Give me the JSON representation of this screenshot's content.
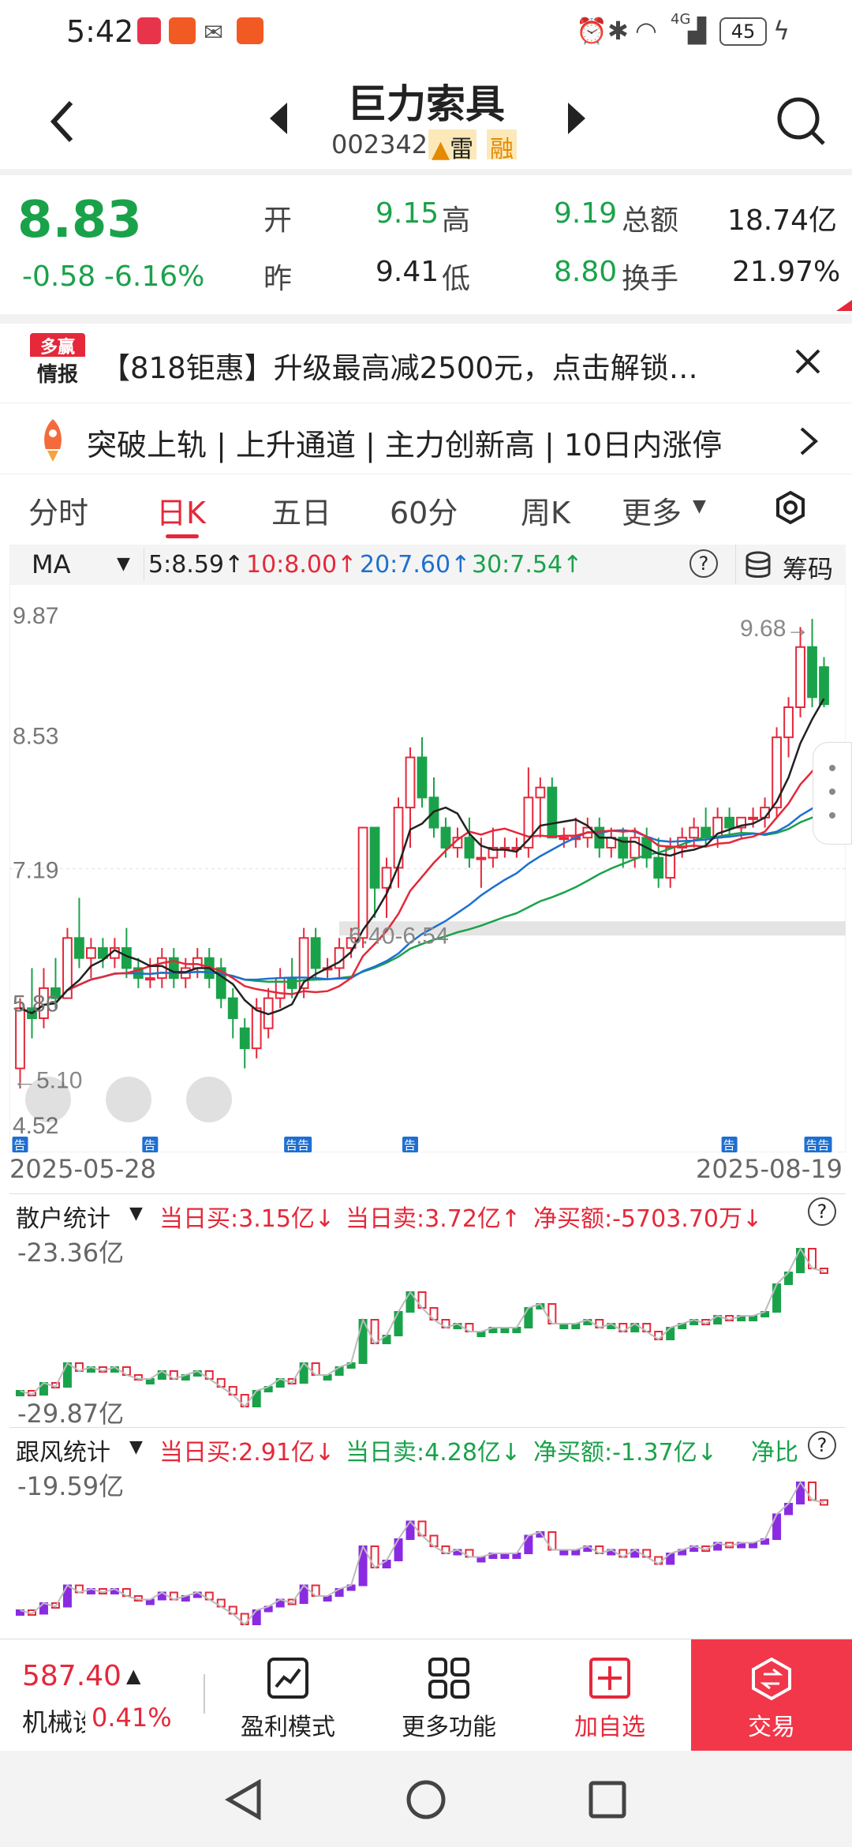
{
  "status": {
    "time": "5:42",
    "battery": "45",
    "network": "4G"
  },
  "nav": {
    "title": "巨力索具",
    "code": "002342",
    "lei": "雷",
    "rong": "融"
  },
  "quote": {
    "price": "8.83",
    "change": "-0.58",
    "pct": "-6.16%",
    "open_label": "开",
    "open": "9.15",
    "high_label": "高",
    "high": "9.19",
    "amount_label": "总额",
    "amount": "18.74亿",
    "prev_label": "昨",
    "prev": "9.41",
    "low_label": "低",
    "low": "8.80",
    "turnover_label": "换手",
    "turnover": "21.97%"
  },
  "ad": {
    "logo_top": "多赢",
    "logo_bottom": "情报",
    "text": "【818钜惠】升级最高减2500元，点击解锁…"
  },
  "ticker": {
    "text": "突破上轨 | 上升通道 | 主力创新高 | 10日内涨停"
  },
  "tabs": [
    "分时",
    "日K",
    "五日",
    "60分",
    "周K",
    "更多"
  ],
  "active_tab": "日K",
  "ma": {
    "label": "MA",
    "ma5": "5:8.59↑",
    "ma10": "10:8.00↑",
    "ma20": "20:7.60↑",
    "ma30": "30:7.54↑",
    "chips": "筹码"
  },
  "chart_data": {
    "type": "candlestick",
    "y_ticks": [
      "9.87",
      "8.53",
      "7.19",
      "5.86",
      "4.52"
    ],
    "ylim": [
      4.52,
      9.87
    ],
    "date_start": "2025-05-28",
    "date_end": "2025-08-19",
    "max_label": "9.68→",
    "zone_label": "6.40-6.54",
    "min_label": "←5.10",
    "ohlc": [
      [
        5.2,
        5.9,
        5.0,
        5.8
      ],
      [
        5.8,
        6.2,
        5.5,
        5.7
      ],
      [
        5.7,
        6.2,
        5.6,
        6.0
      ],
      [
        6.0,
        6.3,
        5.8,
        5.9
      ],
      [
        5.9,
        6.6,
        5.9,
        6.5
      ],
      [
        6.5,
        6.9,
        6.2,
        6.3
      ],
      [
        6.3,
        6.5,
        6.1,
        6.4
      ],
      [
        6.4,
        6.5,
        6.2,
        6.3
      ],
      [
        6.3,
        6.5,
        6.2,
        6.4
      ],
      [
        6.4,
        6.6,
        6.1,
        6.2
      ],
      [
        6.2,
        6.3,
        6.0,
        6.1
      ],
      [
        6.1,
        6.3,
        6.0,
        6.1
      ],
      [
        6.1,
        6.4,
        6.0,
        6.3
      ],
      [
        6.3,
        6.4,
        6.0,
        6.1
      ],
      [
        6.1,
        6.3,
        6.0,
        6.2
      ],
      [
        6.2,
        6.4,
        6.1,
        6.3
      ],
      [
        6.3,
        6.4,
        6.0,
        6.1
      ],
      [
        6.2,
        6.3,
        5.8,
        5.9
      ],
      [
        5.9,
        6.0,
        5.5,
        5.7
      ],
      [
        5.6,
        5.7,
        5.2,
        5.4
      ],
      [
        5.4,
        5.9,
        5.3,
        5.8
      ],
      [
        5.6,
        6.0,
        5.5,
        5.9
      ],
      [
        5.9,
        6.2,
        5.8,
        6.1
      ],
      [
        6.1,
        6.3,
        5.9,
        6.0
      ],
      [
        6.0,
        6.6,
        5.9,
        6.5
      ],
      [
        6.5,
        6.6,
        6.1,
        6.2
      ],
      [
        6.2,
        6.3,
        6.1,
        6.2
      ],
      [
        6.2,
        6.5,
        6.1,
        6.4
      ],
      [
        6.4,
        6.6,
        6.3,
        6.5
      ],
      [
        6.5,
        7.6,
        6.4,
        7.6
      ],
      [
        7.6,
        7.6,
        6.7,
        7.0
      ],
      [
        7.0,
        7.3,
        6.7,
        7.2
      ],
      [
        7.2,
        7.9,
        7.0,
        7.8
      ],
      [
        7.8,
        8.4,
        7.4,
        8.3
      ],
      [
        8.3,
        8.5,
        7.8,
        7.9
      ],
      [
        7.9,
        8.1,
        7.5,
        7.6
      ],
      [
        7.6,
        7.7,
        7.3,
        7.4
      ],
      [
        7.4,
        7.6,
        7.3,
        7.5
      ],
      [
        7.5,
        7.7,
        7.2,
        7.3
      ],
      [
        7.3,
        7.5,
        7.0,
        7.3
      ],
      [
        7.3,
        7.6,
        7.2,
        7.4
      ],
      [
        7.4,
        7.5,
        7.3,
        7.4
      ],
      [
        7.4,
        7.5,
        7.3,
        7.4
      ],
      [
        7.4,
        8.2,
        7.3,
        7.9
      ],
      [
        7.9,
        8.1,
        7.5,
        8.0
      ],
      [
        8.0,
        8.1,
        7.5,
        7.5
      ],
      [
        7.5,
        7.6,
        7.4,
        7.5
      ],
      [
        7.5,
        7.7,
        7.4,
        7.5
      ],
      [
        7.5,
        7.7,
        7.4,
        7.6
      ],
      [
        7.6,
        7.7,
        7.3,
        7.4
      ],
      [
        7.4,
        7.6,
        7.3,
        7.5
      ],
      [
        7.5,
        7.6,
        7.2,
        7.3
      ],
      [
        7.3,
        7.6,
        7.2,
        7.5
      ],
      [
        7.5,
        7.6,
        7.2,
        7.3
      ],
      [
        7.3,
        7.5,
        7.0,
        7.1
      ],
      [
        7.1,
        7.5,
        7.0,
        7.4
      ],
      [
        7.4,
        7.6,
        7.3,
        7.5
      ],
      [
        7.5,
        7.7,
        7.4,
        7.6
      ],
      [
        7.6,
        7.8,
        7.4,
        7.5
      ],
      [
        7.5,
        7.8,
        7.4,
        7.7
      ],
      [
        7.7,
        7.8,
        7.5,
        7.6
      ],
      [
        7.6,
        7.7,
        7.5,
        7.7
      ],
      [
        7.7,
        7.8,
        7.6,
        7.7
      ],
      [
        7.7,
        7.9,
        7.6,
        7.8
      ],
      [
        7.8,
        8.6,
        7.7,
        8.5
      ],
      [
        8.5,
        8.9,
        8.3,
        8.8
      ],
      [
        8.8,
        9.6,
        8.7,
        9.4
      ],
      [
        9.4,
        9.68,
        8.8,
        8.9
      ],
      [
        9.2,
        9.3,
        8.8,
        8.83
      ]
    ]
  },
  "retail": {
    "title": "散户统计",
    "buy": "当日买:3.15亿↓",
    "sell": "当日卖:3.72亿↑",
    "net": "净买额:-5703.70万↓",
    "top": "-23.36亿",
    "bottom": "-29.87亿"
  },
  "follow": {
    "title": "跟风统计",
    "buy": "当日买:2.91亿↓",
    "sell": "当日卖:4.28亿↓",
    "net": "净买额:-1.37亿↓",
    "extra": "净比",
    "top": "-19.59亿"
  },
  "bottom": {
    "index": "587.40",
    "index_name": "机械设",
    "index_pct": "0.41%",
    "b1": "盈利模式",
    "b2": "更多功能",
    "b3": "加自选",
    "b4": "交易"
  },
  "ann": "告",
  "colors": {
    "up": "#e5283a",
    "down": "#1aa24a",
    "ma5": "#222222",
    "ma10": "#e5283a",
    "ma20": "#1f6fd1",
    "ma30": "#1aa24a",
    "purple": "#8a2be2"
  }
}
